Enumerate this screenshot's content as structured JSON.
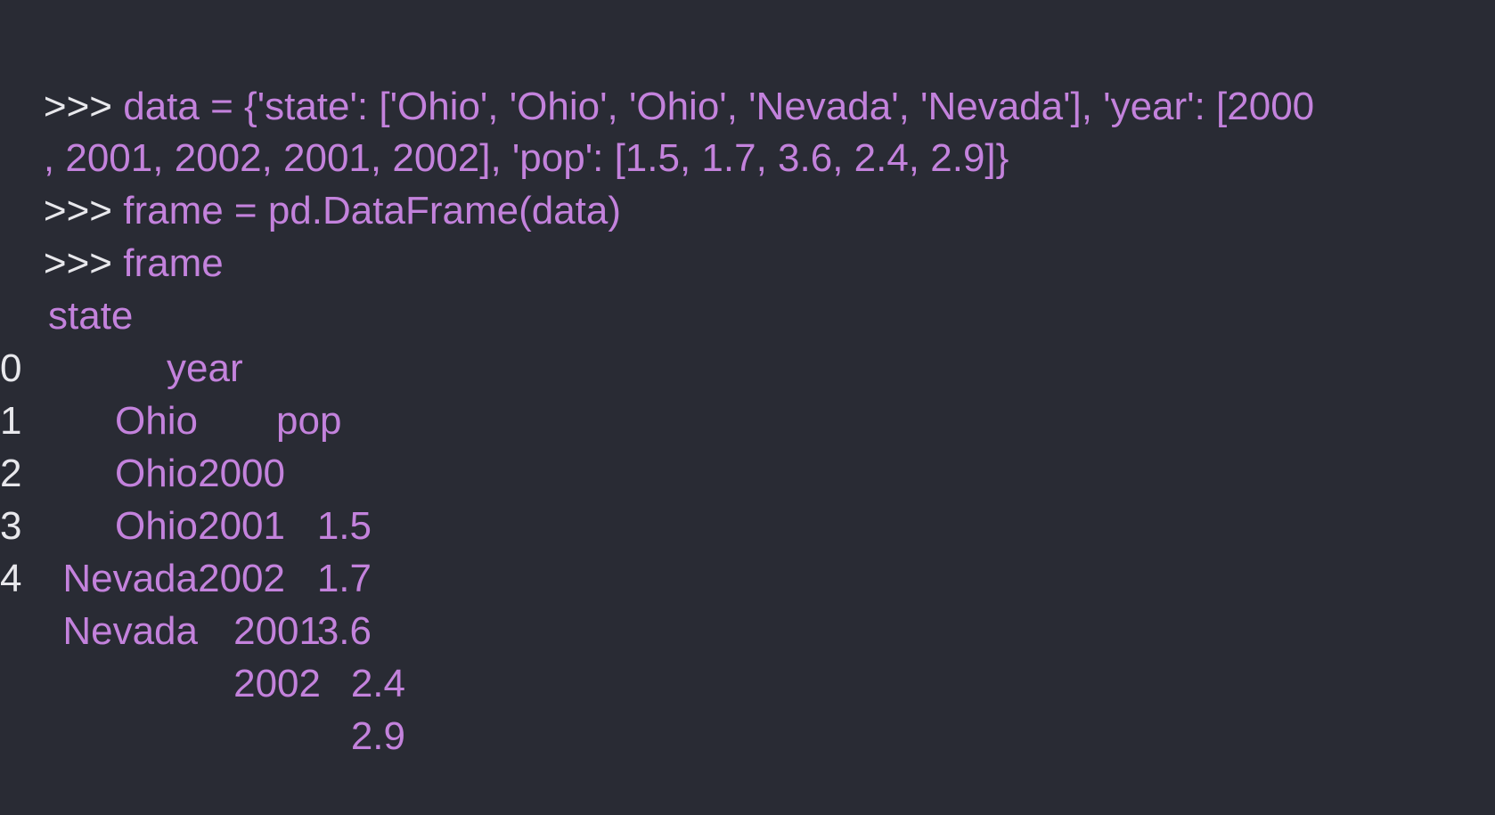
{
  "session": {
    "prompt": ">>>",
    "commands": [
      {
        "text_line1": " data = {'state': ['Ohio', 'Ohio', 'Ohio', 'Nevada', 'Nevada'], 'year': [2000",
        "text_line2": ", 2001, 2002, 2001, 2002], 'pop': [1.5, 1.7, 3.6, 2.4, 2.9]}"
      },
      {
        "text": " frame = pd.DataFrame(data)"
      },
      {
        "text": " frame"
      }
    ]
  },
  "output_table": {
    "columns": [
      "state",
      "year",
      "pop"
    ],
    "rows": [
      {
        "index": "0",
        "state": "Ohio",
        "year": "2000",
        "pop": "1.5"
      },
      {
        "index": "1",
        "state": "Ohio",
        "year": "2001",
        "pop": "1.7"
      },
      {
        "index": "2",
        "state": "Ohio",
        "year": "2002",
        "pop": "3.6"
      },
      {
        "index": "3",
        "state": "Nevada",
        "year": "2001",
        "pop": "2.4"
      },
      {
        "index": "4",
        "state": "Nevada",
        "year": "2002",
        "pop": "2.9"
      }
    ]
  },
  "colors": {
    "background": "#292b34",
    "prompt": "#e8e8ec",
    "code": "#c382dc"
  }
}
